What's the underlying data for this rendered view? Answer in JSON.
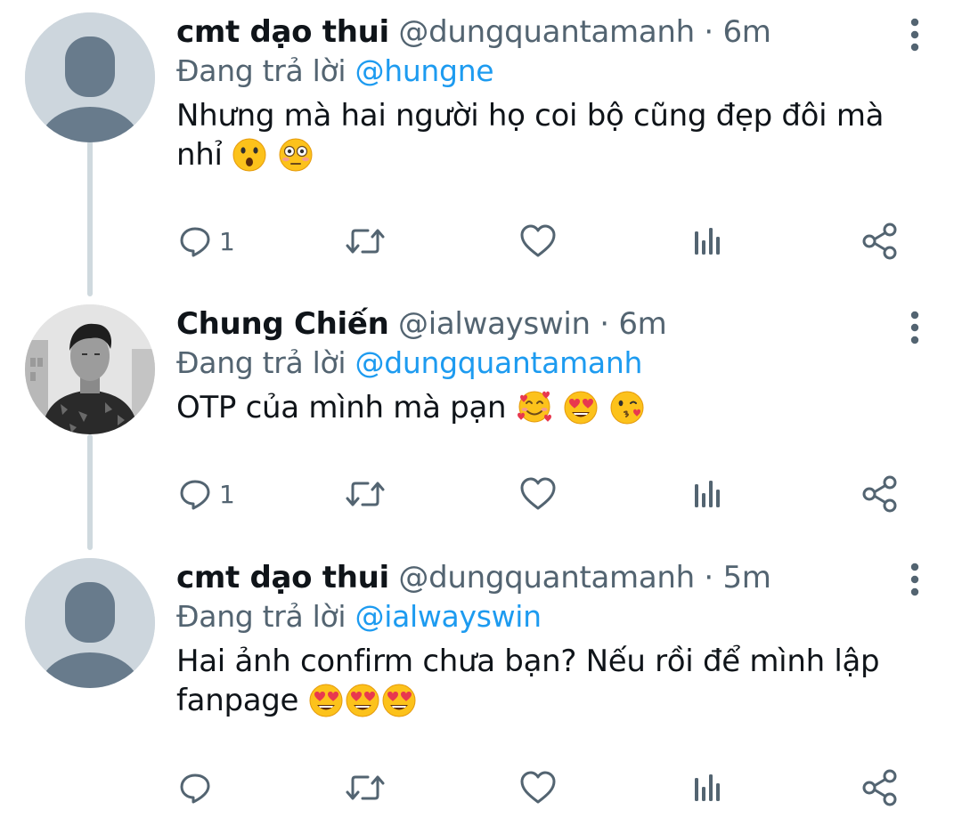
{
  "tweets": [
    {
      "display_name": "cmt dạo thui",
      "handle": "@dungquantamanh",
      "separator": "·",
      "time": "6m",
      "reply_prefix": "Đang trả lời",
      "reply_to": "@hungne",
      "text": "Nhưng mà hai người họ coi bộ cũng đẹp đôi mà nhỉ",
      "emojis": [
        "hushed-face-emoji",
        "flushed-face-emoji"
      ],
      "avatar": "default-avatar",
      "reply_count": "1"
    },
    {
      "display_name": "Chung Chiến",
      "handle": "@ialwayswin",
      "separator": "·",
      "time": "6m",
      "reply_prefix": "Đang trả lời",
      "reply_to": "@dungquantamanh",
      "text": "OTP của mình mà pạn",
      "emojis": [
        "smiling-face-with-hearts-emoji",
        "heart-eyes-emoji",
        "face-blowing-kiss-emoji"
      ],
      "avatar": "photo-avatar",
      "reply_count": "1"
    },
    {
      "display_name": "cmt dạo thui",
      "handle": "@dungquantamanh",
      "separator": "·",
      "time": "5m",
      "reply_prefix": "Đang trả lời",
      "reply_to": "@ialwayswin",
      "text_line1": "Hai ảnh confirm chưa bạn? Nếu rồi để mình lập",
      "text_line2": "fanpage",
      "emojis": [
        "heart-eyes-emoji",
        "heart-eyes-emoji",
        "heart-eyes-emoji"
      ],
      "avatar": "default-avatar",
      "reply_count": ""
    }
  ],
  "icons": [
    "reply-icon",
    "retweet-icon",
    "like-icon",
    "analytics-icon",
    "share-icon",
    "more-options-icon"
  ],
  "colors": {
    "link": "#1d9bf0",
    "secondary_text": "#536471",
    "primary_text": "#0f1419",
    "thread_line": "#cfd9de",
    "avatar_bg": "#cdd6dd",
    "avatar_figure": "#687b8c"
  }
}
